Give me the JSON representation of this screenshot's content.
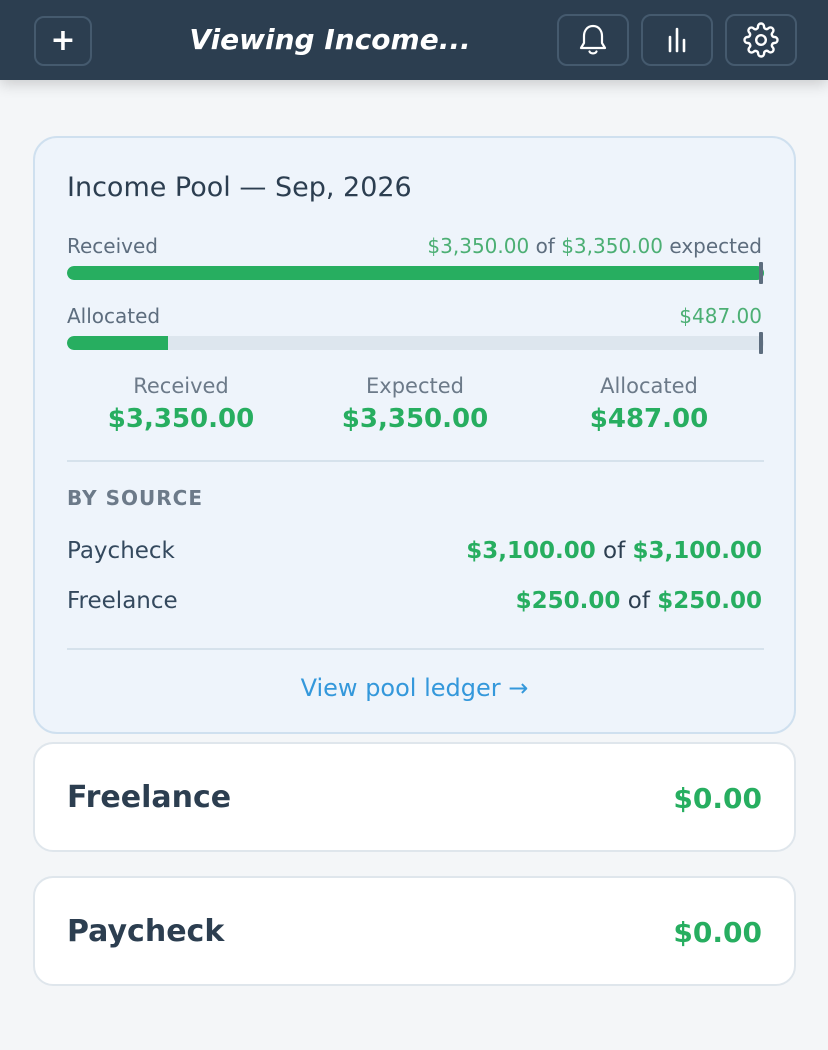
{
  "topbar": {
    "title": "Viewing Income...",
    "add_label": "+",
    "icons": [
      "plus-icon",
      "bell-icon",
      "bar-chart-icon",
      "gear-icon"
    ]
  },
  "pool": {
    "title": "Income Pool — Sep, 2026",
    "received_bar": {
      "label": "Received",
      "received": "$3,350.00",
      "of": "of",
      "expected": "$3,350.00",
      "suffix": "expected",
      "fraction": 1.0
    },
    "allocated_bar": {
      "label": "Allocated",
      "amount": "$487.00",
      "fraction": 0.145
    },
    "stats": [
      {
        "label": "Received",
        "value": "$3,350.00"
      },
      {
        "label": "Expected",
        "value": "$3,350.00"
      },
      {
        "label": "Allocated",
        "value": "$487.00"
      }
    ],
    "by_source_heading": "BY SOURCE",
    "sources": [
      {
        "name": "Paycheck",
        "received": "$3,100.00",
        "of": "of",
        "expected": "$3,100.00"
      },
      {
        "name": "Freelance",
        "received": "$250.00",
        "of": "of",
        "expected": "$250.00"
      }
    ],
    "ledger_link": "View pool ledger →"
  },
  "categories": [
    {
      "name": "Freelance",
      "amount": "$0.00"
    },
    {
      "name": "Paycheck",
      "amount": "$0.00"
    }
  ],
  "colors": {
    "header": "#2c3e50",
    "accent_green": "#27ae60",
    "link_blue": "#3498db"
  }
}
